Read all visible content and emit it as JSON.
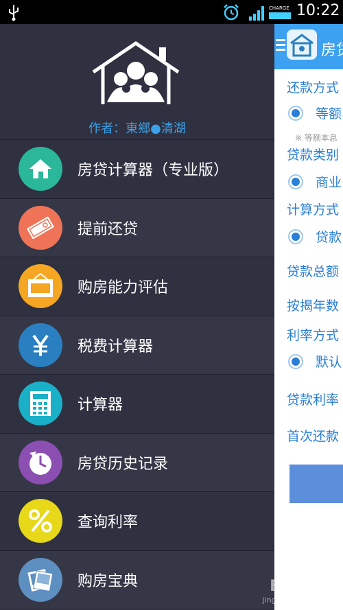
{
  "status_bar": {
    "charge_text": "CHARGE",
    "time": "10:22"
  },
  "app": {
    "title": "房贷",
    "form": {
      "repay_method_label": "还款方式",
      "repay_option": "等额",
      "repay_note": "※ 等额本息",
      "loan_type_label": "贷款类别",
      "loan_type_option": "商业",
      "calc_method_label": "计算方式",
      "calc_method_option": "贷款",
      "loan_total_label": "贷款总额",
      "years_label": "按揭年数",
      "rate_method_label": "利率方式",
      "rate_method_option": "默认",
      "loan_rate_label": "贷款利率",
      "first_payment_label": "首次还款"
    }
  },
  "drawer": {
    "author": "作者：東鄉●清湖",
    "items": [
      {
        "label": "房贷计算器（专业版）",
        "icon": "home-icon",
        "color": "#2bb79a"
      },
      {
        "label": "提前还贷",
        "icon": "cash-icon",
        "color": "#ee7357"
      },
      {
        "label": "购房能力评估",
        "icon": "evaluate-icon",
        "color": "#f5a623"
      },
      {
        "label": "税费计算器",
        "icon": "yen-icon",
        "color": "#2a7fc0"
      },
      {
        "label": "计算器",
        "icon": "calculator-icon",
        "color": "#1ab0c8"
      },
      {
        "label": "房贷历史记录",
        "icon": "clock-icon",
        "color": "#8a4fb0"
      },
      {
        "label": "查询利率",
        "icon": "percent-icon",
        "color": "#e8d81a"
      },
      {
        "label": "购房宝典",
        "icon": "photos-icon",
        "color": "#5d8fc0"
      }
    ]
  },
  "watermark": {
    "brand": "Bai 经验",
    "url": "jingyan.baidu.com"
  }
}
